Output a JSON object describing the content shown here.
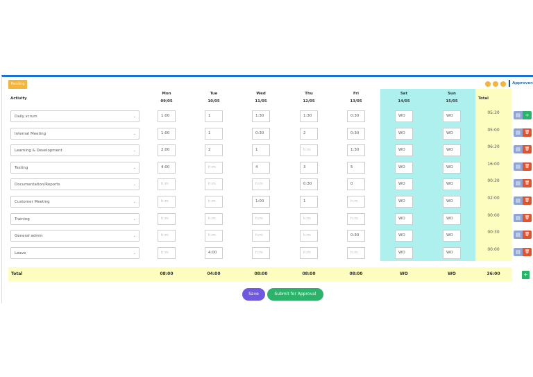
{
  "status_badge": "Pending",
  "approver_label": "Approver:",
  "columns": {
    "activity": "Activity",
    "total": "Total",
    "days": [
      {
        "day": "Mon",
        "date": "09/05"
      },
      {
        "day": "Tue",
        "date": "10/05"
      },
      {
        "day": "Wed",
        "date": "11/05"
      },
      {
        "day": "Thu",
        "date": "12/05"
      },
      {
        "day": "Fri",
        "date": "13/05"
      },
      {
        "day": "Sat",
        "date": "14/05"
      },
      {
        "day": "Sun",
        "date": "15/05"
      }
    ]
  },
  "placeholder": "h:m",
  "rows": [
    {
      "activity": "Daily scrum",
      "hours": [
        "1:00",
        "1",
        "1:30",
        "1:30",
        "0:30",
        "WO",
        "WO"
      ],
      "total": "05:30"
    },
    {
      "activity": "Internal Meeting",
      "hours": [
        "1:00",
        "1",
        "0:30",
        "2",
        "0:30",
        "WO",
        "WO"
      ],
      "total": "05:00"
    },
    {
      "activity": "Learning & Development",
      "hours": [
        "2:00",
        "2",
        "1",
        "",
        "1:30",
        "WO",
        "WO"
      ],
      "total": "06:30"
    },
    {
      "activity": "Testing",
      "hours": [
        "4:00",
        "",
        "4",
        "3",
        "5",
        "WO",
        "WO"
      ],
      "total": "16:00"
    },
    {
      "activity": "Documentation/Reports",
      "hours": [
        "",
        "",
        "",
        "0:30",
        "0",
        "WO",
        "WO"
      ],
      "total": "00:30"
    },
    {
      "activity": "Customer Meeting",
      "hours": [
        "",
        "",
        "1:00",
        "1",
        "",
        "WO",
        "WO"
      ],
      "total": "02:00"
    },
    {
      "activity": "Training",
      "hours": [
        "",
        "",
        "",
        "",
        "",
        "WO",
        "WO"
      ],
      "total": "00:00"
    },
    {
      "activity": "General admin",
      "hours": [
        "",
        "",
        "",
        "",
        "0:30",
        "WO",
        "WO"
      ],
      "total": "00:30"
    },
    {
      "activity": "Leave",
      "hours": [
        "",
        "4:00",
        "",
        "",
        "",
        "WO",
        "WO"
      ],
      "total": "00:00"
    }
  ],
  "totals": {
    "label": "Total",
    "days": [
      "08:00",
      "04:00",
      "08:00",
      "08:00",
      "08:00",
      "WO",
      "WO"
    ],
    "grand": "36:00"
  },
  "buttons": {
    "save": "Save",
    "submit": "Submit for Approval"
  },
  "colors": {
    "accent": "#1a73d1",
    "pending": "#f5b43a",
    "weekend": "#aef0ee",
    "total": "#fdfdbf",
    "save": "#7058e0",
    "submit": "#2bb36a",
    "delete": "#e0532e"
  }
}
